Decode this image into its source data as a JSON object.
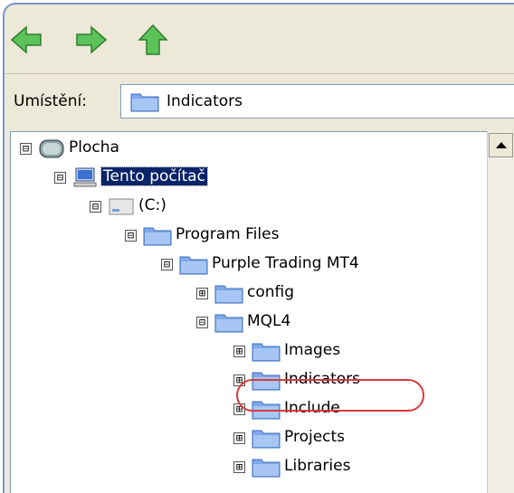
{
  "toolbar": {
    "back_icon": "back-arrow-icon",
    "forward_icon": "forward-arrow-icon",
    "up_icon": "up-arrow-icon"
  },
  "location": {
    "label": "Umístění:",
    "value": "Indicators"
  },
  "tree": {
    "nodes": [
      {
        "label": "Plocha",
        "expander": "⊟"
      },
      {
        "label": "Tento počítač",
        "expander": "⊟",
        "selected": true
      },
      {
        "label": "(C:)",
        "expander": "⊟"
      },
      {
        "label": "Program Files",
        "expander": "⊟"
      },
      {
        "label": "Purple Trading MT4",
        "expander": "⊟"
      },
      {
        "label": "config",
        "expander": "⊞"
      },
      {
        "label": "MQL4",
        "expander": "⊟"
      },
      {
        "label": "Images",
        "expander": "⊞"
      },
      {
        "label": "Indicators",
        "expander": "⊞",
        "highlighted": true
      },
      {
        "label": "Include",
        "expander": "⊞"
      },
      {
        "label": "Projects",
        "expander": "⊞"
      },
      {
        "label": "Libraries",
        "expander": "⊞"
      }
    ]
  },
  "colors": {
    "arrow": "#4fb04f",
    "folder": "#6f9de6",
    "selection": "#0a246a",
    "highlight": "#d83a3a"
  }
}
